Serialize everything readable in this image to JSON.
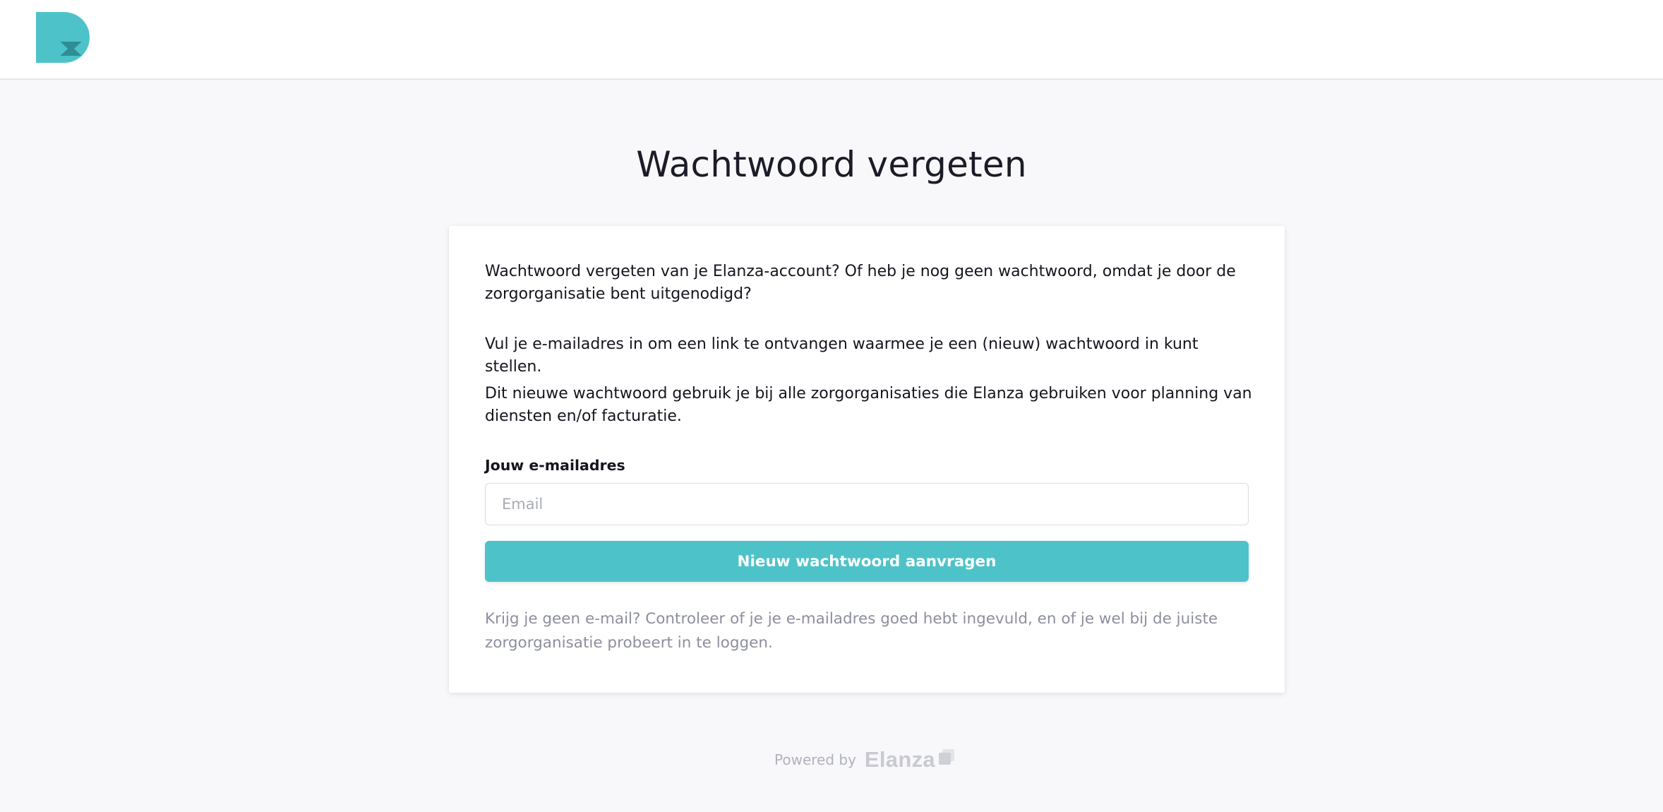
{
  "header": {
    "logo_icon": "dz-logo-icon",
    "colors": {
      "teal": "#4dc3c9",
      "dark_teal": "#2e8d95"
    }
  },
  "page": {
    "title": "Wachtwoord vergeten"
  },
  "form": {
    "intro_1": "Wachtwoord vergeten van je Elanza-account? Of heb je nog geen wachtwoord, omdat je door de zorgorganisatie bent uitgenodigd?",
    "intro_2": "Vul je e-mailadres in om een link te ontvangen waarmee je een (nieuw) wachtwoord in kunt stellen.",
    "intro_3": "Dit nieuwe wachtwoord gebruik je bij alle zorgorganisaties die Elanza gebruiken voor planning van diensten en/of facturatie.",
    "email_label": "Jouw e-mailadres",
    "email_value": "",
    "email_placeholder": "Email",
    "submit_label": "Nieuw wachtwoord aanvragen",
    "help_text": "Krijg je geen e-mail? Controleer of je je e-mailadres goed hebt ingevuld, en of je wel bij de juiste zorgorganisatie probeert in te loggen."
  },
  "footer": {
    "powered_by": "Powered by",
    "brand": "Elanza",
    "brand_icon": "elanza-cube-icon"
  },
  "colors": {
    "background": "#f8f8fa",
    "card": "#ffffff",
    "primary_button": "#4dc3c9",
    "muted_text": "#8d8e9f"
  }
}
